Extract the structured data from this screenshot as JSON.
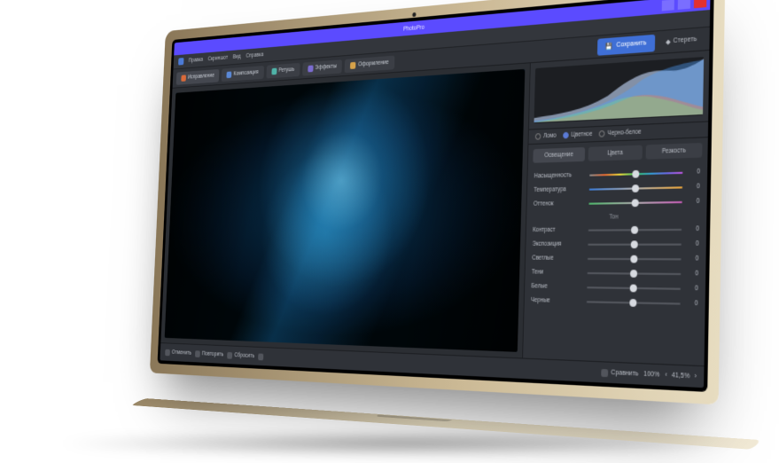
{
  "app": {
    "title": "PhotoPro"
  },
  "menu": {
    "items": [
      "Правка",
      "Скриншот",
      "Вид",
      "Справка"
    ]
  },
  "toolbar": {
    "tabs": [
      {
        "label": "Исправление",
        "icon": "ic-red",
        "active": true
      },
      {
        "label": "Композиция",
        "icon": "ic-blue"
      },
      {
        "label": "Ретушь",
        "icon": "ic-teal"
      },
      {
        "label": "Эффекты",
        "icon": "ic-vio"
      },
      {
        "label": "Оформление",
        "icon": "ic-orn"
      }
    ],
    "save_label": "Сохранить",
    "clear_label": "Стереть"
  },
  "panel": {
    "filters": [
      {
        "label": "Ломо",
        "on": false
      },
      {
        "label": "Цветное",
        "on": true
      },
      {
        "label": "Черно-белое",
        "on": false
      }
    ],
    "quick": [
      {
        "label": "Освещение",
        "on": true
      },
      {
        "label": "Цвета",
        "on": false
      },
      {
        "label": "Резкость",
        "on": false
      }
    ],
    "group1": [
      {
        "label": "Насыщенность",
        "cls": "sat",
        "val": "0",
        "pos": 50
      },
      {
        "label": "Температура",
        "cls": "temp",
        "val": "0",
        "pos": 50
      },
      {
        "label": "Оттенок",
        "cls": "tint",
        "val": "0",
        "pos": 50
      }
    ],
    "subhead": "Тон",
    "group2": [
      {
        "label": "Контраст",
        "cls": "grey",
        "val": "0",
        "pos": 50
      },
      {
        "label": "Экспозиция",
        "cls": "grey",
        "val": "0",
        "pos": 50
      },
      {
        "label": "Светлые",
        "cls": "grey",
        "val": "0",
        "pos": 50
      },
      {
        "label": "Тени",
        "cls": "grey",
        "val": "0",
        "pos": 50
      },
      {
        "label": "Белые",
        "cls": "grey",
        "val": "0",
        "pos": 50
      },
      {
        "label": "Черные",
        "cls": "grey",
        "val": "0",
        "pos": 50
      }
    ]
  },
  "bottom": {
    "undo": "Отменить",
    "redo": "Повторить",
    "reset": "Сбросить",
    "compare": "Сравнить",
    "zoom": "100%",
    "fit": "41,5%"
  }
}
